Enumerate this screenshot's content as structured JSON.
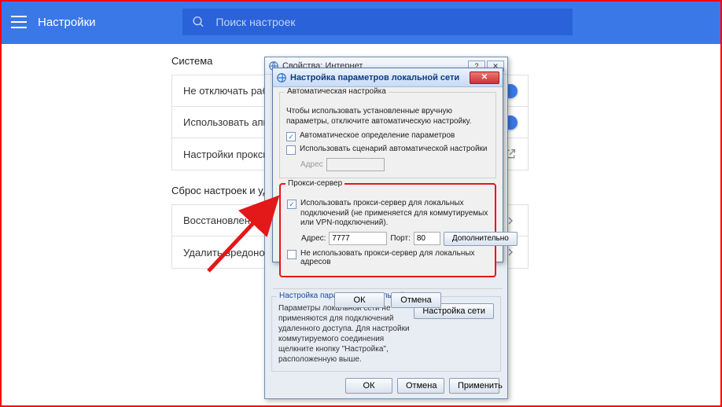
{
  "topbar": {
    "title": "Настройки",
    "search_placeholder": "Поиск настроек"
  },
  "sections": {
    "system_title": "Система",
    "system_rows": [
      "Не отключать рабо",
      "Использовать аппа",
      "Настройки прокси-с"
    ],
    "reset_title": "Сброс настроек и уд",
    "reset_rows": [
      "Восстановление на",
      "Удалить вредоносн"
    ]
  },
  "outer_win": {
    "title": "Свойства: Интернет",
    "group_title": "Настройка параметров локальной сети",
    "desc": "Параметры локальной сети не применяются для подключений удаленного доступа. Для настройки коммутируемого соединения щелкните кнопку \"Настройка\", расположенную выше.",
    "net_button": "Настройка сети",
    "ok": "ОК",
    "cancel": "Отмена",
    "apply": "Применить"
  },
  "inner_win": {
    "title": "Настройка параметров локальной сети",
    "auto_group": "Автоматическая настройка",
    "auto_note": "Чтобы использовать установленные вручную параметры, отключите автоматическую настройку.",
    "auto_detect": "Автоматическое определение параметров",
    "use_script": "Использовать сценарий автоматической настройки",
    "addr_label": "Адрес",
    "proxy_group": "Прокси-сервер",
    "use_proxy": "Использовать прокси-сервер для локальных подключений (не применяется для коммутируемых или VPN-подключений).",
    "addr2_label": "Адрес:",
    "addr2_value": "7777",
    "port_label": "Порт:",
    "port_value": "80",
    "advanced": "Дополнительно",
    "bypass": "Не использовать прокси-сервер для локальных адресов",
    "ok": "ОК",
    "cancel": "Отмена"
  }
}
